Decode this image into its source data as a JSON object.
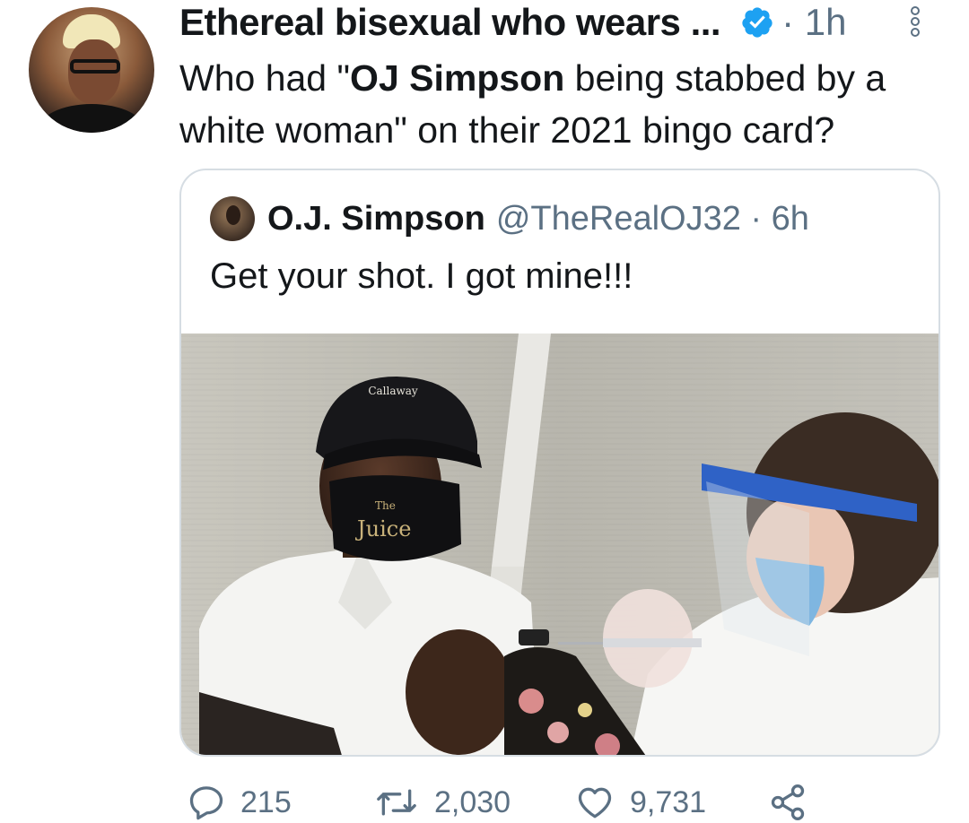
{
  "tweet": {
    "author_name": "Ethereal bisexual who wears ...",
    "time": "· 1h",
    "text_before": "Who had \"",
    "text_bold": "OJ Simpson",
    "text_after": " being stabbed by a white woman\" on their 2021 bingo card?"
  },
  "quote": {
    "author_name": "O.J. Simpson",
    "handle_time": "@TheRealOJ32 · 6h",
    "text": "Get your shot. I got mine!!!",
    "image_text": {
      "cap": "Callaway",
      "mask_small": "The",
      "mask_big": "Juice"
    }
  },
  "actions": {
    "replies": "215",
    "retweets": "2,030",
    "likes": "9,731"
  },
  "colors": {
    "text": "#14171a",
    "secondary": "#5b7083",
    "verified": "#1da1f2",
    "border": "#d6dde3"
  }
}
